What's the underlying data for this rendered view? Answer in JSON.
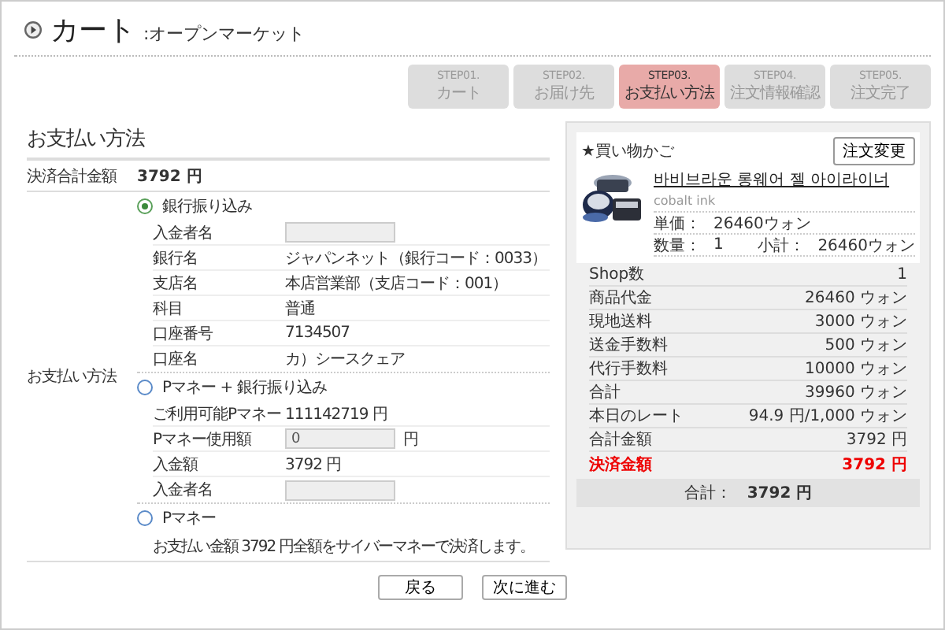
{
  "header": {
    "title": "カート",
    "subtitle": ":オープンマーケット"
  },
  "steps": [
    {
      "step": "STEP01.",
      "label": "カート",
      "selected": false
    },
    {
      "step": "STEP02.",
      "label": "お届け先",
      "selected": false
    },
    {
      "step": "STEP03.",
      "label": "お支払い方法",
      "selected": true
    },
    {
      "step": "STEP04.",
      "label": "注文情報確認",
      "selected": false
    },
    {
      "step": "STEP05.",
      "label": "注文完了",
      "selected": false
    }
  ],
  "payment": {
    "heading": "お支払い方法",
    "total_label": "決済合計金額",
    "total_value": "3792 円",
    "method_label": "お支払い方法",
    "options": [
      {
        "label": "銀行振り込み",
        "selected": true,
        "rows": [
          {
            "kind": "field",
            "label": "入金者名"
          },
          {
            "kind": "text",
            "label": "銀行名",
            "value": "ジャパンネット（銀行コード：0033）"
          },
          {
            "kind": "text",
            "label": "支店名",
            "value": "本店営業部（支店コード：001）"
          },
          {
            "kind": "text",
            "label": "科目",
            "value": "普通"
          },
          {
            "kind": "text",
            "label": "口座番号",
            "value": "7134507"
          },
          {
            "kind": "text",
            "label": "口座名",
            "value": "カ）シースクェア"
          }
        ]
      },
      {
        "label": "Pマネー + 銀行振り込み",
        "selected": false,
        "rows": [
          {
            "kind": "text",
            "label": "ご利用可能Pマネー",
            "value": "111142719 円"
          },
          {
            "kind": "field",
            "label": "Pマネー使用額",
            "value": "0",
            "unit": "円"
          },
          {
            "kind": "text",
            "label": "入金額",
            "value": "3792 円"
          },
          {
            "kind": "field",
            "label": "入金者名"
          }
        ]
      },
      {
        "label": "Pマネー",
        "selected": false,
        "rows": [
          {
            "kind": "note",
            "text": "お支払い金額 3792 円全額をサイバーマネーで決済します。"
          }
        ]
      }
    ]
  },
  "cart": {
    "title": "★買い物かご",
    "change_button": "注文変更",
    "product": {
      "name": "바비브라운 롱웨어 젤 아이라이너",
      "variant": "cobalt ink",
      "unit_price_label": "単価：",
      "unit_price": "26460ウォン",
      "quantity_label": "数量：",
      "quantity": "1",
      "subtotal_label": "小計：",
      "subtotal": "26460ウォン"
    },
    "summary": [
      {
        "label": "Shop数",
        "value": "1",
        "highlight": false
      },
      {
        "label": "商品代金",
        "value": "26460 ウォン",
        "highlight": false
      },
      {
        "label": "現地送料",
        "value": "3000 ウォン",
        "highlight": false
      },
      {
        "label": "送金手数料",
        "value": "500 ウォン",
        "highlight": false
      },
      {
        "label": "代行手数料",
        "value": "10000 ウォン",
        "highlight": false
      },
      {
        "label": "合計",
        "value": "39960 ウォン",
        "highlight": false
      },
      {
        "label": "本日のレート",
        "value": "94.9 円/1,000 ウォン",
        "highlight": false
      },
      {
        "label": "合計金額",
        "value": "3792 円",
        "highlight": false
      },
      {
        "label": "決済金額",
        "value": "3792 円",
        "highlight": true
      }
    ],
    "total_label": "合計：",
    "total_value": "3792 円"
  },
  "buttons": [
    "戻る",
    "次に進む"
  ]
}
